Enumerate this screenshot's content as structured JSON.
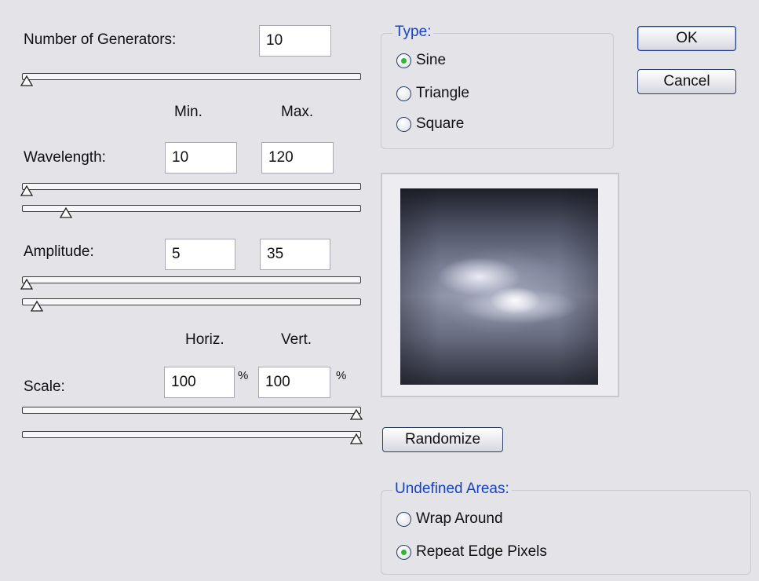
{
  "generators": {
    "label": "Number of Generators:",
    "value": "10",
    "slider_fraction": 0.0
  },
  "col_headers": {
    "min": "Min.",
    "max": "Max.",
    "horiz": "Horiz.",
    "vert": "Vert."
  },
  "wavelength": {
    "label": "Wavelength:",
    "min": "10",
    "max": "120",
    "min_fraction": 0.0,
    "max_fraction": 0.12
  },
  "amplitude": {
    "label": "Amplitude:",
    "min": "5",
    "max": "35",
    "min_fraction": 0.0,
    "max_fraction": 0.03
  },
  "scale": {
    "label": "Scale:",
    "horiz": "100",
    "vert": "100",
    "unit": "%",
    "horiz_fraction": 1.0,
    "vert_fraction": 1.0
  },
  "type_group": {
    "legend": "Type:",
    "options": [
      {
        "label": "Sine",
        "checked": true
      },
      {
        "label": "Triangle",
        "checked": false
      },
      {
        "label": "Square",
        "checked": false
      }
    ]
  },
  "buttons": {
    "ok": "OK",
    "cancel": "Cancel",
    "randomize": "Randomize"
  },
  "undefined_group": {
    "legend": "Undefined Areas:",
    "options": [
      {
        "label": "Wrap Around",
        "checked": false
      },
      {
        "label": "Repeat Edge Pixels",
        "checked": true
      }
    ]
  },
  "colors": {
    "legend": "#1443c8",
    "radio_dot": "#2eb82e",
    "background": "#e4e3e8"
  }
}
